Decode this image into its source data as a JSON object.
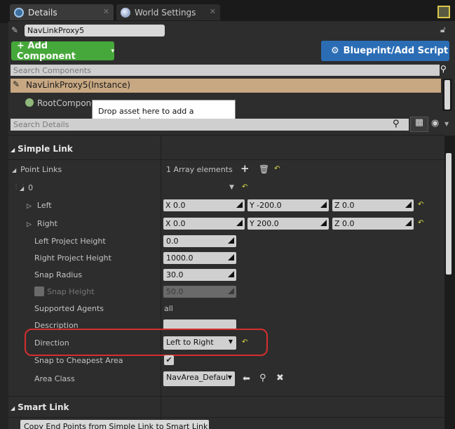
{
  "tabs": [
    {
      "label": "Details"
    },
    {
      "label": "World Settings"
    }
  ],
  "actor_name": "NavLinkProxy5",
  "toolbar": {
    "add_component": "+ Add Component",
    "blueprint": "Blueprint/Add Script"
  },
  "components": {
    "search_placeholder": "Search Components",
    "instance": "NavLinkProxy5(Instance)",
    "root": "RootCompone",
    "tooltip": "Drop asset here to add a component."
  },
  "details": {
    "search_placeholder": "Search Details"
  },
  "simple_link": {
    "title": "Simple Link",
    "point_links": {
      "label": "Point Links",
      "value": "1 Array elements"
    },
    "index": "0",
    "left": {
      "label": "Left",
      "x": "X  0.0",
      "y": "Y  -200.0",
      "z": "Z  0.0"
    },
    "right": {
      "label": "Right",
      "x": "X  0.0",
      "y": "Y  200.0",
      "z": "Z  0.0"
    },
    "left_project_height": {
      "label": "Left Project Height",
      "value": "0.0"
    },
    "right_project_height": {
      "label": "Right Project Height",
      "value": "1000.0"
    },
    "snap_radius": {
      "label": "Snap Radius",
      "value": "30.0"
    },
    "snap_height": {
      "label": "Snap Height",
      "value": "50.0"
    },
    "supported_agents": {
      "label": "Supported Agents",
      "value": "all"
    },
    "description": {
      "label": "Description",
      "value": ""
    },
    "direction": {
      "label": "Direction",
      "value": "Left to Right"
    },
    "snap_cheapest": {
      "label": "Snap to Cheapest Area",
      "checked": true
    },
    "area_class": {
      "label": "Area Class",
      "value": "NavArea_Default"
    }
  },
  "smart_link": {
    "title": "Smart Link",
    "copy_button": "Copy End Points from Simple Link to Smart Link"
  },
  "colors": {
    "highlight": "#d52e2e",
    "add_component": "#46a83a",
    "blueprint": "#2b6db5"
  }
}
